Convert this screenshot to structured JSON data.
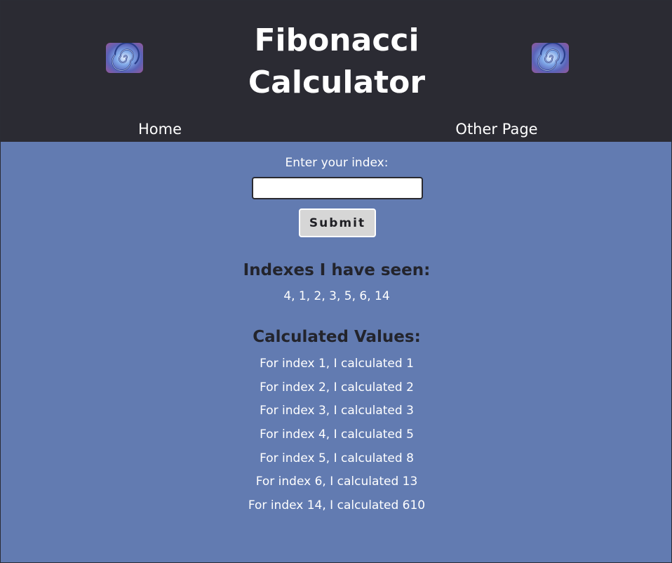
{
  "header": {
    "title_line1": "Fibonacci",
    "title_line2": "Calculator",
    "logo_icon": "spiral-shell-icon",
    "background_color": "#2b2b33"
  },
  "nav": {
    "home_label": "Home",
    "other_label": "Other Page"
  },
  "form": {
    "label": "Enter your index:",
    "input_value": "",
    "submit_label": "Submit"
  },
  "seen": {
    "heading": "Indexes I have seen:",
    "indexes_text": "4, 1, 2, 3, 5, 6, 14"
  },
  "calculated": {
    "heading": "Calculated Values:",
    "items": [
      "For index 1, I calculated 1",
      "For index 2, I calculated 2",
      "For index 3, I calculated 3",
      "For index 4, I calculated 5",
      "For index 5, I calculated 8",
      "For index 6, I calculated 13",
      "For index 14, I calculated 610"
    ]
  },
  "colors": {
    "page_background": "#627bb1",
    "heading_text": "#23242c",
    "button_background": "#d6d6d6"
  }
}
